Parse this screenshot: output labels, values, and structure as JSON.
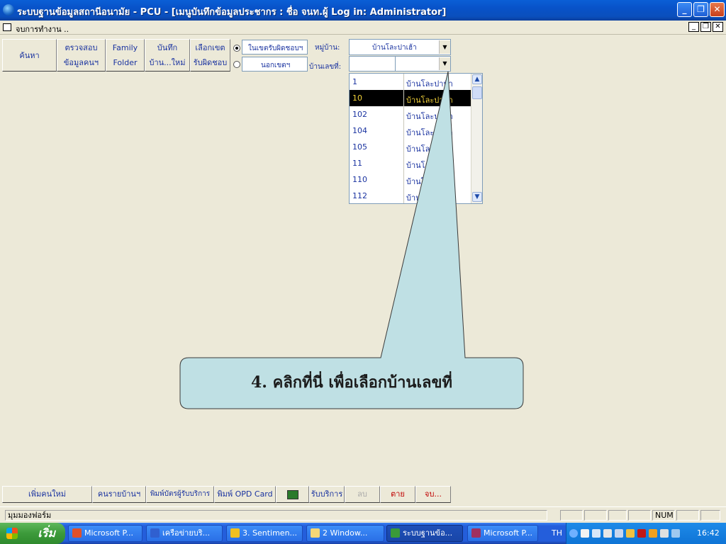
{
  "window": {
    "title": "ระบบฐานข้อมูลสถานีอนามัย - PCU - [เมนูบันทึกข้อมูลประชากร : ชื่อ จนท.ผู้ Log in: Administrator]",
    "minimize": "_",
    "restore": "❐",
    "close": "✕"
  },
  "mdi": {
    "title": "จบการทำงาน ..",
    "minimize": "_",
    "restore": "❐",
    "close": "✕"
  },
  "toolbar": {
    "search": "ค้นหา",
    "check_line1": "ตรวจสอบ",
    "check_line2": "ข้อมูลคนฯ",
    "family_line1": "Family",
    "family_line2": "Folder",
    "record_line1": "บันทึก",
    "record_line2": "บ้าน...ใหม่",
    "area_line1": "เลือกเขต",
    "area_line2": "รับผิดชอบ",
    "radio_inside": "ในเขตรับผิดชอบฯ",
    "radio_outside": "นอกเขตฯ",
    "village_label": "หมู่บ้าน:",
    "village_value": "บ้านโละปาเฮ้า",
    "house_label": "บ้านเลขที่:",
    "house_value": ""
  },
  "house_list": {
    "rows": [
      {
        "no": "1",
        "village": "บ้านโละปาห้า"
      },
      {
        "no": "10",
        "village": "บ้านโละปาห้า"
      },
      {
        "no": "102",
        "village": "บ้านโละปาห้า"
      },
      {
        "no": "104",
        "village": "บ้านโละปาห้า"
      },
      {
        "no": "105",
        "village": "บ้านโละปาห้า"
      },
      {
        "no": "11",
        "village": "บ้านโละปาห้า"
      },
      {
        "no": "110",
        "village": "บ้านโละปาห้า"
      },
      {
        "no": "112",
        "village": "บ้านโละปาห้า"
      }
    ],
    "selected_index": 1
  },
  "callout": {
    "text": "4. คลิกที่นี่ เพื่อเลือกบ้านเลขที่",
    "fill": "#bfe0e4"
  },
  "bottom_buttons": {
    "add_person": "เพิ่มคนใหม่",
    "household": "คนรายบ้านฯ",
    "print_card": "พิมพ์บัตรผู้รับบริการ",
    "print_opd": "พิมพ์ OPD Card",
    "service": "รับบริการ",
    "delete": "ลบ",
    "dead": "ตาย",
    "exit": "จบ..."
  },
  "statusbar": {
    "form_view": "มุมมองฟอร์ม",
    "num": "NUM"
  },
  "taskbar": {
    "start": "เริ่ม",
    "tasks": [
      {
        "label": "Microsoft P...",
        "icon": "powerpoint-icon"
      },
      {
        "label": "เครือข่ายบริ...",
        "icon": "word-icon"
      },
      {
        "label": "3. Sentimen...",
        "icon": "app-icon"
      },
      {
        "label": "2 Window...",
        "icon": "folder-icon"
      },
      {
        "label": "ระบบฐานข้อ...",
        "icon": "globe-icon"
      },
      {
        "label": "Microsoft P...",
        "icon": "access-icon"
      }
    ],
    "lang": "TH",
    "clock": "16:42"
  }
}
